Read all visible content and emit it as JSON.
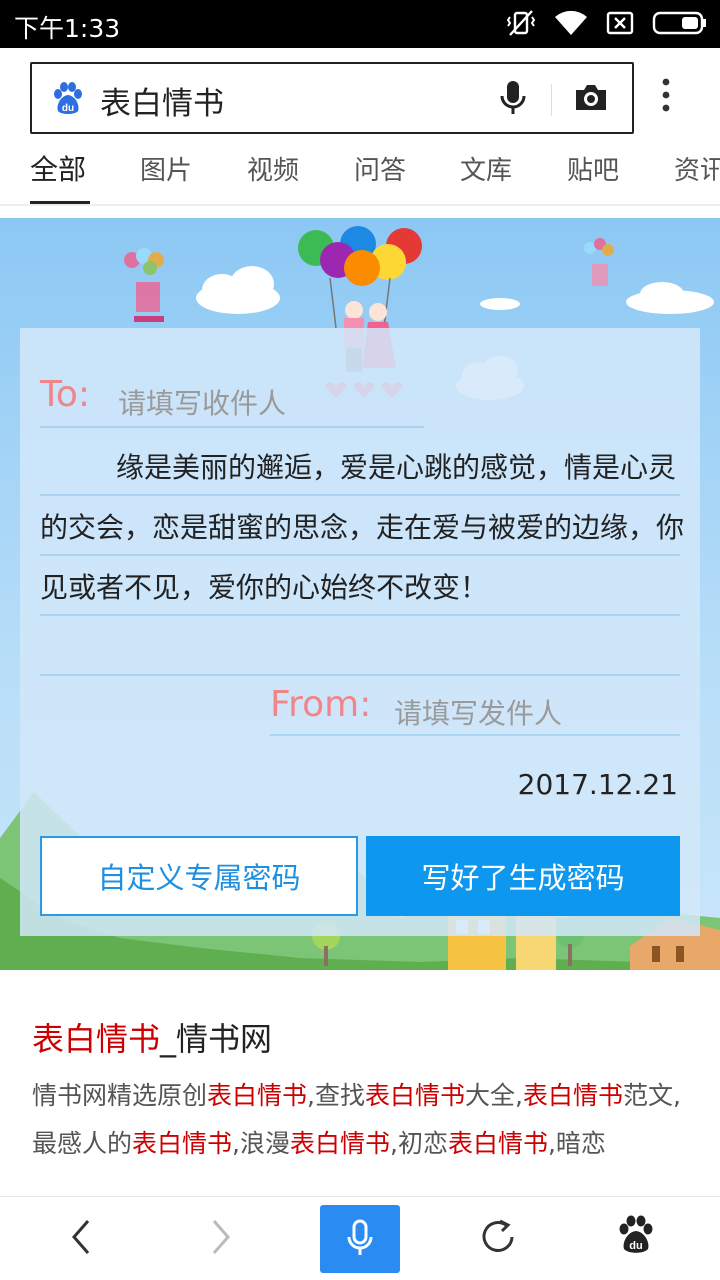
{
  "status_bar": {
    "time": "下午1:33",
    "icons": [
      "vibrate-off-icon",
      "wifi-icon",
      "sim-x-icon",
      "battery-icon"
    ]
  },
  "search": {
    "query": "表白情书",
    "icons": [
      "baidu-paw-icon",
      "mic-icon",
      "camera-icon",
      "more-vertical-icon"
    ]
  },
  "tabs": [
    {
      "label": "全部",
      "active": true
    },
    {
      "label": "图片"
    },
    {
      "label": "视频"
    },
    {
      "label": "问答"
    },
    {
      "label": "文库"
    },
    {
      "label": "贴吧"
    },
    {
      "label": "资讯"
    }
  ],
  "letter_card": {
    "to_label": "To:",
    "to_placeholder": "请填写收件人",
    "body": "缘是美丽的邂逅，爱是心跳的感觉，情是心灵的交会，恋是甜蜜的思念，走在爱与被爱的边缘，你见或者不见，爱你的心始终不改变！",
    "from_label": "From:",
    "from_placeholder": "请填写发件人",
    "date": "2017.12.21",
    "button_custom": "自定义专属密码",
    "button_generate": "写好了生成密码"
  },
  "result": {
    "title_highlight": "表白情书",
    "title_rest": "_情书网",
    "snippet": [
      {
        "t": "情书网精选原创"
      },
      {
        "t": "表白情书",
        "hl": true
      },
      {
        "t": ",查找"
      },
      {
        "t": "表白情书",
        "hl": true
      },
      {
        "t": "大全,"
      },
      {
        "t": "表白情书",
        "hl": true
      },
      {
        "t": "范文,最感人的"
      },
      {
        "t": "表白情书",
        "hl": true
      },
      {
        "t": ",浪漫"
      },
      {
        "t": "表白情书",
        "hl": true
      },
      {
        "t": ",初恋"
      },
      {
        "t": "表白情书",
        "hl": true
      },
      {
        "t": ",暗恋"
      }
    ]
  },
  "bottom_bar": {
    "icons": [
      "back-icon",
      "forward-icon",
      "voice-search-icon",
      "refresh-icon",
      "baidu-home-icon"
    ]
  },
  "colors": {
    "accent": "#0d97ef",
    "highlight": "#cc0000",
    "letter_label": "#f0868a"
  }
}
